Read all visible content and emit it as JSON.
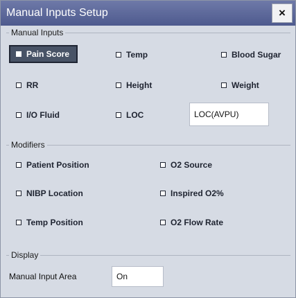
{
  "window": {
    "title": "Manual Inputs Setup",
    "close_label": "×"
  },
  "manual_inputs": {
    "legend": "Manual Inputs",
    "items": [
      {
        "label": "Pain Score",
        "checked": true
      },
      {
        "label": "Temp",
        "checked": false
      },
      {
        "label": "Blood Sugar",
        "checked": false
      },
      {
        "label": "RR",
        "checked": false
      },
      {
        "label": "Height",
        "checked": false
      },
      {
        "label": "Weight",
        "checked": false
      },
      {
        "label": "I/O Fluid",
        "checked": false
      },
      {
        "label": "LOC",
        "checked": false
      }
    ],
    "loc_field_value": "LOC(AVPU)"
  },
  "modifiers": {
    "legend": "Modifiers",
    "items": [
      {
        "label": "Patient Position",
        "checked": false
      },
      {
        "label": "O2 Source",
        "checked": false
      },
      {
        "label": "NIBP Location",
        "checked": false
      },
      {
        "label": "Inspired O2%",
        "checked": false
      },
      {
        "label": "Temp Position",
        "checked": false
      },
      {
        "label": "O2 Flow Rate",
        "checked": false
      }
    ]
  },
  "display": {
    "legend": "Display",
    "manual_input_area_label": "Manual Input Area",
    "manual_input_area_value": "On"
  }
}
